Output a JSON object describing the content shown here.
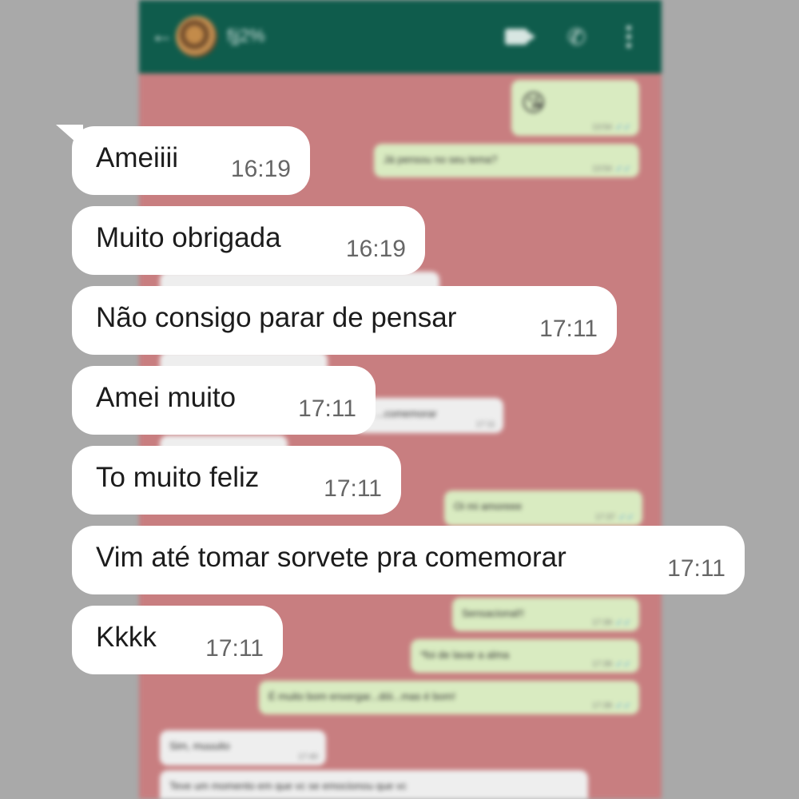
{
  "background_chat": {
    "contact_name": "fjj2%",
    "messages": [
      {
        "direction": "out",
        "text": "😘",
        "time": "13:54",
        "status": "read"
      },
      {
        "direction": "out",
        "text": "Já pensou no seu tema?",
        "time": "13:54",
        "status": "read"
      },
      {
        "direction": "in",
        "text": "...comemorar",
        "time": "17:11"
      },
      {
        "direction": "out",
        "text": "Oi mi amoreee",
        "time": "17:37",
        "status": "read"
      },
      {
        "direction": "out",
        "text": "Sensacional!!",
        "time": "17:39",
        "status": "read"
      },
      {
        "direction": "out",
        "text": "*foi de lavar a alma",
        "time": "17:39",
        "status": "read"
      },
      {
        "direction": "out",
        "text": "É muito bom enxergar...dói...mas é bom!",
        "time": "17:39",
        "status": "read"
      },
      {
        "direction": "in",
        "text": "Sim, muuuito",
        "time": "17:40"
      },
      {
        "direction": "in",
        "text": "Teve um momento em que vc se emocionou que vc",
        "time": ""
      }
    ]
  },
  "messages": [
    {
      "text": "Ameiiii",
      "time": "16:19"
    },
    {
      "text": "Muito obrigada",
      "time": "16:19"
    },
    {
      "text": "Não consigo parar de pensar",
      "time": "17:11"
    },
    {
      "text": "Amei muito",
      "time": "17:11"
    },
    {
      "text": "To muito feliz",
      "time": "17:11"
    },
    {
      "text": "Vim até tomar sorvete pra comemorar",
      "time": "17:11"
    },
    {
      "text": "Kkkk",
      "time": "17:11"
    }
  ],
  "colors": {
    "page_background": "#a9a9a9",
    "chat_wallpaper": "#c87e80",
    "header": "#0f5c4c",
    "bubble": "#ffffff",
    "outgoing_bubble": "#d9ebc1",
    "read_check": "#4fa3d8"
  },
  "icons": [
    "back-arrow-icon",
    "video-call-icon",
    "phone-icon",
    "more-options-icon",
    "read-check-icon"
  ]
}
